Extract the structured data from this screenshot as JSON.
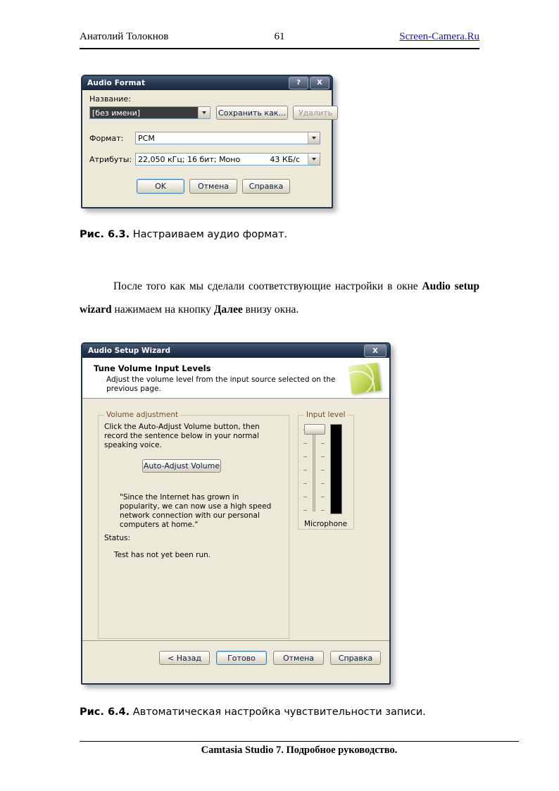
{
  "page": {
    "header": {
      "author": "Анатолий Толокнов",
      "page_number": "61",
      "site": "Screen-Camera.Ru"
    },
    "footer": {
      "text": "Camtasia Studio 7. Подробное руководство."
    },
    "paragraph": {
      "part1": "После того как мы сделали соответствующие настройки в окне ",
      "bold1": "Audio setup wizard",
      "part2": " нажимаем на кнопку ",
      "bold2": "Далее",
      "part3": " внизу окна."
    },
    "caption_63": {
      "number": "Рис. 6.3.",
      "text": " Настраиваем аудио формат."
    },
    "caption_64": {
      "number": "Рис. 6.4.",
      "text": " Автоматическая настройка чувствительности записи."
    }
  },
  "audio_format_dialog": {
    "title": "Audio Format",
    "help_button": "?",
    "close_button": "X",
    "name_label": "Название:",
    "name_value": "[без имени]",
    "save_as_button": "Сохранить как...",
    "delete_button": "Удалить",
    "format_label": "Формат:",
    "format_value": "PCM",
    "attributes_label": "Атрибуты:",
    "attributes_value": "22,050 кГц; 16 бит; Моно",
    "attributes_rate": "43 КБ/с",
    "ok_button": "OK",
    "cancel_button": "Отмена",
    "help_btn": "Справка"
  },
  "setup_wizard_dialog": {
    "title": "Audio Setup Wizard",
    "close_button": "X",
    "header_title": "Tune Volume Input Levels",
    "header_subtitle": "Adjust the volume level from the input source selected on the previous page.",
    "volume_group_label": "Volume adjustment",
    "instruction": "Click the Auto-Adjust Volume button, then record the sentence below in your normal speaking voice.",
    "auto_adjust_button": "Auto-Adjust Volume",
    "sample_sentence": "\"Since the Internet has grown in popularity, we can now use a high speed network connection with our personal computers at home.\"",
    "status_label": "Status:",
    "status_value": "Test has not yet been run.",
    "input_level_group_label": "Input level",
    "input_device_label": "Microphone",
    "back_button": "< Назад",
    "finish_button": "Готово",
    "cancel_button": "Отмена",
    "help_button": "Справка"
  },
  "colors": {
    "link": "#1414c8",
    "titlebar_dark": "#17263c",
    "dialog_face": "#ece9d8",
    "group_label": "#7a4a2a",
    "meter_black": "#000000"
  }
}
